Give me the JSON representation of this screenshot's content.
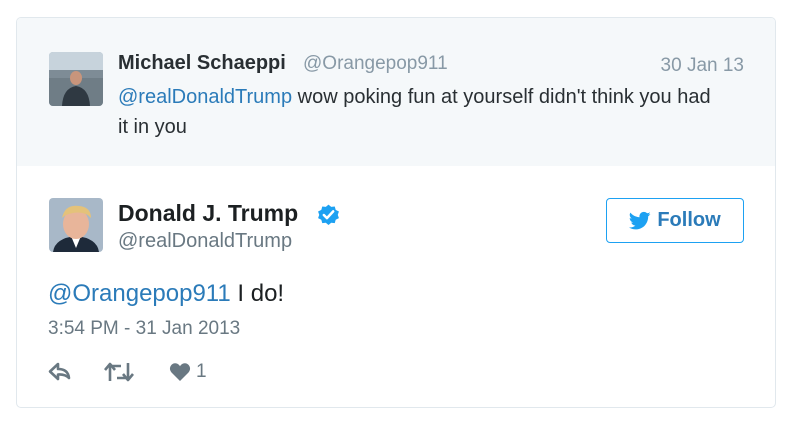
{
  "parent_tweet": {
    "name": "Michael Schaeppi",
    "handle": "@Orangepop911",
    "date": "30 Jan 13",
    "mention": "@realDonaldTrump",
    "text": " wow poking fun at yourself didn't think you had it in you"
  },
  "main_tweet": {
    "name": "Donald J. Trump",
    "handle": "@realDonaldTrump",
    "follow_label": "Follow",
    "mention": "@Orangepop911",
    "text": " I do!",
    "timestamp": "3:54 PM - 31 Jan 2013",
    "like_count": "1"
  },
  "colors": {
    "link": "#2b7bb9",
    "twitter_blue": "#1da1f2",
    "muted": "#8899a6",
    "parent_bg": "#f5f8fa"
  },
  "icons": [
    "reply-icon",
    "retweet-icon",
    "heart-icon",
    "verified-badge-icon",
    "twitter-bird-icon"
  ]
}
